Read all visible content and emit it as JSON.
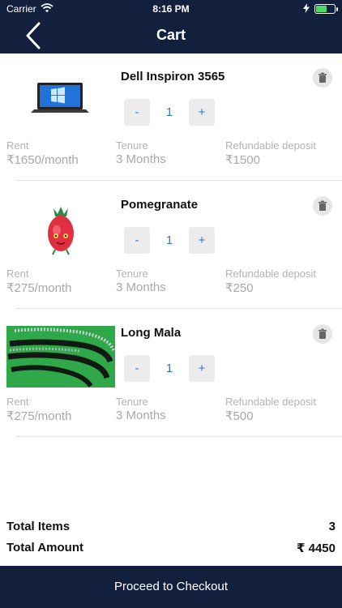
{
  "status_bar": {
    "carrier": "Carrier",
    "time": "8:16 PM"
  },
  "header": {
    "title": "Cart"
  },
  "labels": {
    "rent": "Rent",
    "tenure": "Tenure",
    "deposit": "Refundable deposit",
    "minus": "-",
    "plus": "+"
  },
  "items": [
    {
      "name": "Dell Inspiron 3565",
      "qty": "1",
      "rent": "₹1650/month",
      "tenure": "3 Months",
      "deposit": "₹1500"
    },
    {
      "name": "Pomegranate",
      "qty": "1",
      "rent": "₹275/month",
      "tenure": "3 Months",
      "deposit": "₹250"
    },
    {
      "name": "Long Mala",
      "qty": "1",
      "rent": "₹275/month",
      "tenure": "3 Months",
      "deposit": "₹500"
    }
  ],
  "totals": {
    "items_label": "Total Items",
    "items_value": "3",
    "amount_label": "Total Amount",
    "amount_value": "₹ 4450"
  },
  "checkout_label": "Proceed to Checkout",
  "colors": {
    "navy": "#13203d",
    "accent_blue": "#2a7ad5",
    "battery_green": "#4cd964"
  },
  "battery_level": 0.6
}
